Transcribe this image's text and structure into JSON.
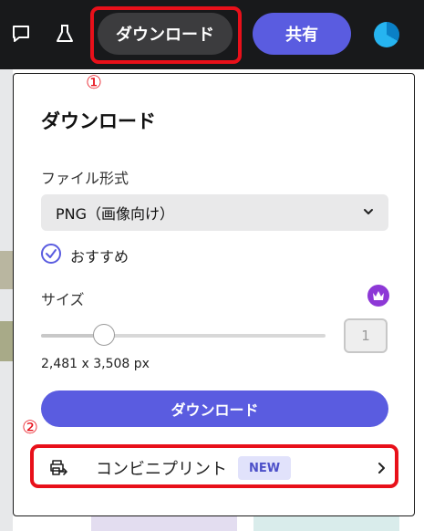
{
  "topbar": {
    "comment_icon": "speech-bubble-icon",
    "flask_icon": "flask-icon",
    "download_label": "ダウンロード",
    "share_label": "共有",
    "avatar_icon": "avatar"
  },
  "annotations": {
    "marker_1": "①",
    "marker_2": "②",
    "highlight_color": "#e8101a"
  },
  "panel": {
    "title": "ダウンロード",
    "file_format": {
      "label": "ファイル形式",
      "selected": "PNG（画像向け）",
      "chevron_icon": "chevron-down-icon"
    },
    "recommended": {
      "label": "おすすめ",
      "checked": true,
      "icon": "check-circle-icon"
    },
    "size": {
      "label": "サイズ",
      "premium_icon": "crown-icon",
      "slider_fraction": 0.22,
      "value": "1",
      "dimensions": "2,481 x 3,508 px"
    },
    "download_button": "ダウンロード",
    "print_row": {
      "icon": "print-handoff-icon",
      "label": "コンビニプリント",
      "badge": "NEW",
      "chevron_icon": "chevron-right-icon"
    }
  },
  "colors": {
    "accent": "#5a5ce0",
    "topbar_bg": "#18191b",
    "premium": "#8d38d6"
  }
}
